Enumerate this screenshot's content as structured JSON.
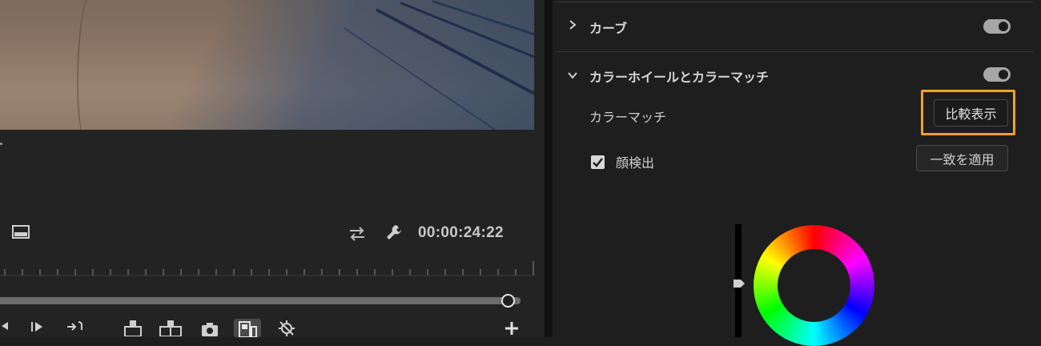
{
  "monitor": {
    "timecode": "00:00:24:22",
    "icons": {
      "safe_margins": "safe-margins-icon",
      "loop": "loop-icon",
      "settings": "wrench-icon",
      "transport": [
        "step-back-icon",
        "step-forward-icon",
        "go-to-out-icon",
        "lift-icon",
        "extract-icon",
        "camera-icon",
        "comparison-view-icon",
        "disable-effects-icon",
        "add-icon"
      ]
    },
    "playhead_fraction": 0.975
  },
  "lumetri": {
    "sections": [
      {
        "title": "カーブ",
        "expanded": false,
        "enabled": true
      },
      {
        "title": "カラーホイールとカラーマッチ",
        "expanded": true,
        "enabled": true
      }
    ],
    "color_match": {
      "label": "カラーマッチ",
      "compare_button": "比較表示",
      "apply_button": "一致を適用",
      "face_detect_label": "顔検出",
      "face_detect_checked": true
    }
  },
  "colors": {
    "highlight": "#f0a030",
    "toggle_on": "#a6a6a6",
    "panel_bg": "#1e1e1e"
  }
}
